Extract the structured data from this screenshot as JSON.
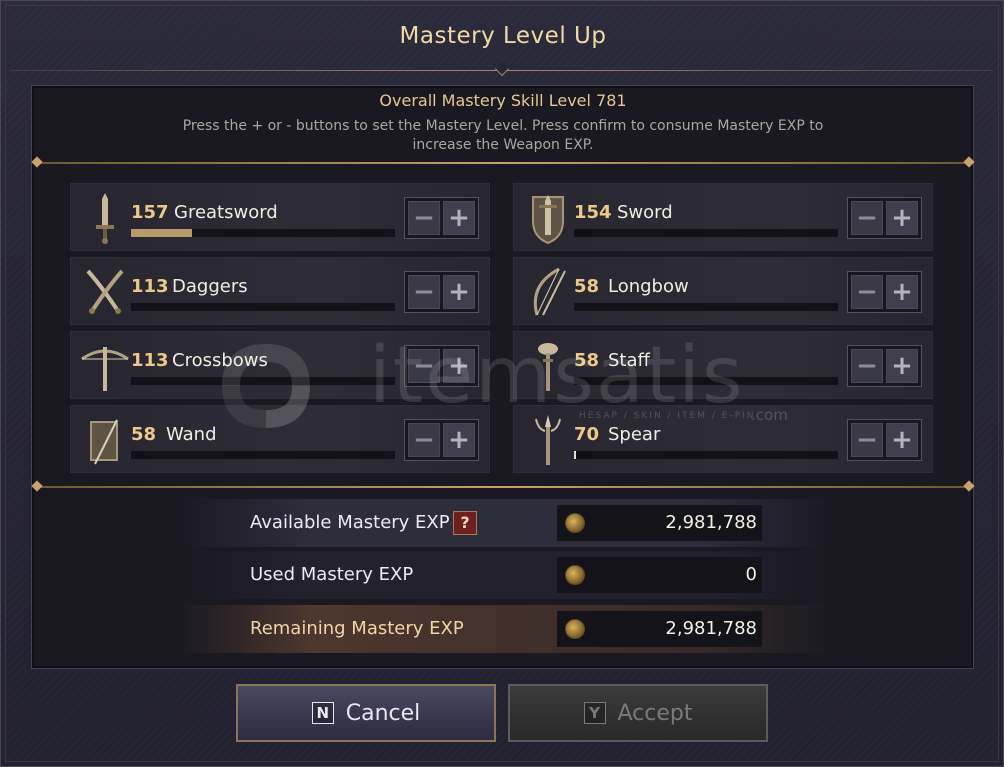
{
  "window": {
    "title": "Mastery Level Up"
  },
  "header": {
    "overall_label": "Overall Mastery Skill Level 781",
    "instructions": "Press the + or - buttons to set the Mastery Level. Press confirm to consume Mastery EXP to increase the Weapon EXP."
  },
  "skills": [
    {
      "level": "157",
      "name": "Greatsword",
      "progress": 0.23,
      "icon": "greatsword-icon"
    },
    {
      "level": "154",
      "name": "Sword",
      "progress": 0,
      "icon": "sword-icon"
    },
    {
      "level": "113",
      "name": "Daggers",
      "progress": 0,
      "icon": "daggers-icon"
    },
    {
      "level": "58",
      "name": "Longbow",
      "progress": 0,
      "icon": "longbow-icon"
    },
    {
      "level": "113",
      "name": "Crossbows",
      "progress": 0,
      "icon": "crossbow-icon"
    },
    {
      "level": "58",
      "name": "Staff",
      "progress": 0,
      "icon": "staff-icon"
    },
    {
      "level": "58",
      "name": "Wand",
      "progress": 0,
      "icon": "wand-icon"
    },
    {
      "level": "70",
      "name": "Spear",
      "progress": 0.01,
      "icon": "spear-icon"
    }
  ],
  "stepper": {
    "minus": "−",
    "plus": "+"
  },
  "exp": {
    "available_label": "Available Mastery EXP",
    "available_value": "2,981,788",
    "help": "?",
    "used_label": "Used Mastery EXP",
    "used_value": "0",
    "remaining_label": "Remaining Mastery EXP",
    "remaining_value": "2,981,788"
  },
  "buttons": {
    "cancel_key": "N",
    "cancel_label": "Cancel",
    "accept_key": "Y",
    "accept_label": "Accept"
  },
  "watermark": {
    "text": "itemsatis",
    "sub": "HESAP / SKIN / ITEM / E-PIN",
    "suffix": ".com"
  },
  "colors": {
    "accent_gold": "#ecc98a",
    "panel_bg": "#1a1922",
    "help_red": "#6e1f1f"
  }
}
